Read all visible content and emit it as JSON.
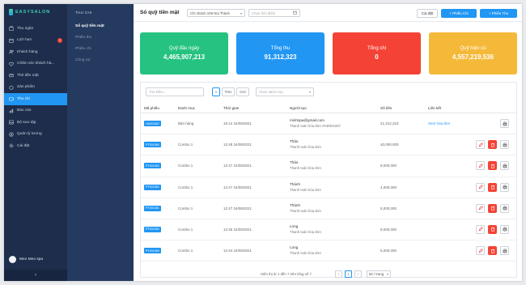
{
  "brand": {
    "name": "EASYSALON"
  },
  "sidebar": {
    "items": [
      {
        "label": "Thu ngân",
        "icon": "cashier-icon"
      },
      {
        "label": "Lịch hẹn",
        "icon": "calendar-icon",
        "badge": "1"
      },
      {
        "label": "Khách hàng",
        "icon": "customers-icon"
      },
      {
        "label": "Chăm sóc khách hà...",
        "icon": "care-icon"
      },
      {
        "label": "Thẻ tiền mặt",
        "icon": "card-icon"
      },
      {
        "label": "Sản phẩm",
        "icon": "product-icon"
      },
      {
        "label": "Thu chi",
        "icon": "wallet-icon",
        "active": true
      },
      {
        "label": "Báo cáo",
        "icon": "report-icon"
      },
      {
        "label": "Bộ sưu tập",
        "icon": "gallery-icon"
      },
      {
        "label": "Quản lý lương",
        "icon": "salary-icon"
      },
      {
        "label": "Cài đặt",
        "icon": "settings-icon"
      }
    ],
    "user": "Meo Meo spa",
    "collapse": "‹"
  },
  "submenu": {
    "title": "THU CHI",
    "items": [
      "Sổ quỹ tiền mặt",
      "Phiếu thu",
      "Phiếu chi",
      "Công nợ"
    ]
  },
  "topbar": {
    "title": "Sổ quỹ tiền mặt",
    "branch": "Chi nhánh 106 Núi Thành",
    "date_placeholder": "Chọn thời điểm",
    "lock_label": "Cài đặt",
    "add_expense": "+ Phiếu Chi",
    "add_income": "+ Phiếu Thu"
  },
  "cards": [
    {
      "label": "Quỹ đầu ngày",
      "value": "4,465,907,213",
      "color": "#26c281"
    },
    {
      "label": "Tổng thu",
      "value": "91,312,323",
      "color": "#2196f3"
    },
    {
      "label": "Tổng chi",
      "value": "0",
      "color": "#f44336"
    },
    {
      "label": "Quỹ hiện có",
      "value": "4,557,219,536",
      "color": "#f5b93a"
    }
  ],
  "filters": {
    "search_placeholder": "Tìm kiếm...",
    "seg_all": "≡",
    "seg_income": "THU",
    "seg_expense": "CHI",
    "category_placeholder": "Chọn danh mục"
  },
  "table": {
    "headers": [
      "Mã phiếu",
      "Danh mục",
      "Thời gian",
      "Người tạo",
      "Số tiền",
      "Liên kết"
    ],
    "rows": [
      {
        "code": "HD001067",
        "category": "Bán hàng",
        "time": "15:12 24/08/2021",
        "creator": "minhspa@gmail.com",
        "note": "Thanh toán hóa đơn #HD001067",
        "amount": "21,312,323",
        "link": "Xem hóa đơn"
      },
      {
        "code": "PT001084",
        "category": "Combo 1",
        "time": "12:48 24/08/2021",
        "creator": "Thảo",
        "note": "Thanh toán hóa đơn",
        "amount": "40,000,000",
        "link": ""
      },
      {
        "code": "PT001083",
        "category": "Combo 1",
        "time": "12:47 24/08/2021",
        "creator": "Thảo",
        "note": "Thanh toán hóa đơn",
        "amount": "8,000,000",
        "link": ""
      },
      {
        "code": "PT001082",
        "category": "Combo 1",
        "time": "12:47 24/08/2021",
        "creator": "Thành",
        "note": "Thanh toán hóa đơn",
        "amount": "4,000,000",
        "link": ""
      },
      {
        "code": "PT001081",
        "category": "Combo 1",
        "time": "12:47 24/08/2021",
        "creator": "Thành",
        "note": "Thanh toán hóa đơn",
        "amount": "5,000,000",
        "link": ""
      },
      {
        "code": "PT001080",
        "category": "Combo 1",
        "time": "12:45 24/08/2021",
        "creator": "Long",
        "note": "Thanh toán hóa đơn",
        "amount": "8,000,000",
        "link": ""
      },
      {
        "code": "PT001089",
        "category": "Combo 1",
        "time": "12:44 24/08/2021",
        "creator": "Long",
        "note": "Thanh toán hóa đơn",
        "amount": "5,000,000",
        "link": ""
      }
    ]
  },
  "pager": {
    "text": "Hiển thị từ 1 đến 7 trên tổng số 7",
    "prev": "‹",
    "page": "1",
    "next": "›",
    "per_page": "50 / trang"
  }
}
